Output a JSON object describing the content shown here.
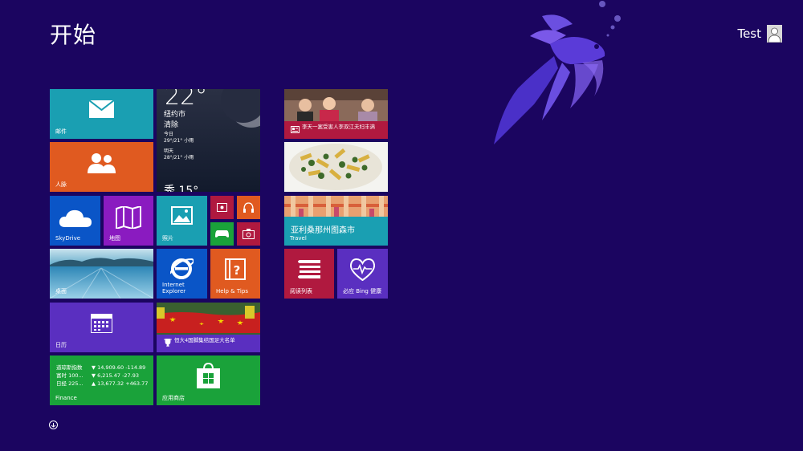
{
  "screen": {
    "title": "开始"
  },
  "user": {
    "name": "Test"
  },
  "tiles": {
    "mail": {
      "label": "邮件"
    },
    "people": {
      "label": "人脉"
    },
    "weather": {
      "temp": "22°",
      "city": "纽约市",
      "cond": "清除",
      "today": "今日",
      "today_val": "29°/21° 小雨",
      "tomorrow": "明天",
      "tomorrow_val": "28°/21° 小雨",
      "partial": "秀 15°"
    },
    "skydrive": {
      "label": "SkyDrive"
    },
    "maps": {
      "label": "地图"
    },
    "photos": {
      "label": "照片"
    },
    "desktop": {
      "label": "桌面"
    },
    "ie": {
      "label": "Internet Explorer"
    },
    "help": {
      "label": "Help & Tips"
    },
    "calendar": {
      "label": "日历"
    },
    "sports": {
      "headline": "恒大4国脚集结国足大名单"
    },
    "finance": {
      "label": "Finance",
      "rows": [
        {
          "name": "道琼斯指数",
          "val": "▼ 14,909.60 -114.89"
        },
        {
          "name": "富时 100...",
          "val": "▼ 6,215.47 -27.93"
        },
        {
          "name": "日经 225...",
          "val": "▲ 13,677.32 +463.77"
        }
      ]
    },
    "store": {
      "label": "应用商店"
    },
    "news": {
      "headline": "李天一案受害人李双江夫妇丰满"
    },
    "travel": {
      "title": "亚利桑那州图森市",
      "label": "Travel"
    },
    "reading": {
      "label": "阅读列表"
    },
    "health": {
      "label": "必应 Bing 健康"
    }
  },
  "colors": {
    "background": "#1b0560",
    "teal": "#1a9fb2",
    "orange": "#e05a20",
    "blue": "#0a55c7",
    "purple": "#8a1bc0",
    "green": "#1aa23a",
    "crimson": "#b0193f",
    "violet": "#5a2fc0"
  }
}
